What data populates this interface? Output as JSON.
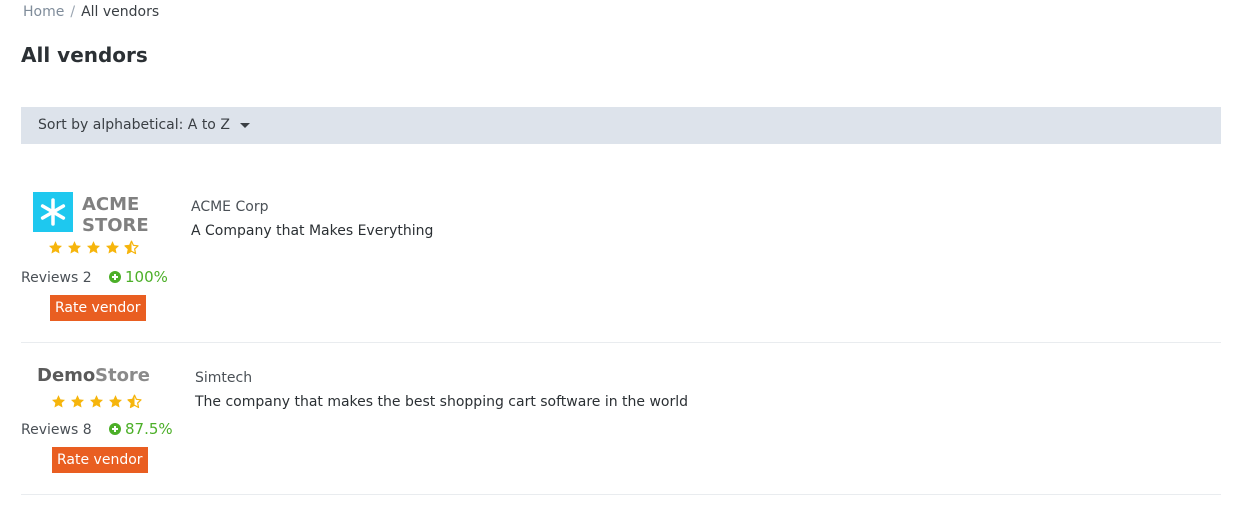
{
  "breadcrumb": {
    "home": "Home",
    "separator": "/",
    "current": "All vendors"
  },
  "page": {
    "title": "All vendors"
  },
  "sort": {
    "label": "Sort by alphabetical: A to Z"
  },
  "colors": {
    "accent": "#e95e21",
    "positive": "#4caf28",
    "star": "#f6b50c",
    "bar": "#dde3eb",
    "acme_logo": "#1ec8ef"
  },
  "vendors": [
    {
      "logo": {
        "line1": "ACME",
        "line2": "STORE",
        "icon": "snowflake-icon"
      },
      "rating": 4.5,
      "reviews_label": "Reviews 2",
      "positive_percent": "100%",
      "rate_label": "Rate vendor",
      "company": "ACME Corp",
      "description": "A Company that Makes Everything"
    },
    {
      "logo": {
        "word1": "Demo",
        "word2": "Store"
      },
      "rating": 4.5,
      "reviews_label": "Reviews 8",
      "positive_percent": "87.5%",
      "rate_label": "Rate vendor",
      "company": "Simtech",
      "description": "The company that makes the best shopping cart software in the world"
    }
  ]
}
